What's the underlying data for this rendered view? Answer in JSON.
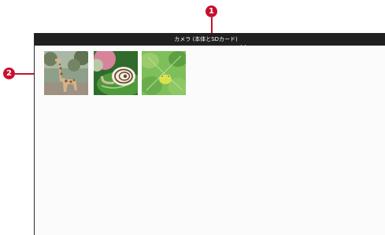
{
  "callouts": {
    "one": "1",
    "two": "2"
  },
  "header": {
    "album_title": "カメラ (本体とSDカード)",
    "dropdown_icon": "chevron-down-icon"
  },
  "thumbnails": [
    {
      "subject": "giraffe"
    },
    {
      "subject": "snail"
    },
    {
      "subject": "frog"
    }
  ],
  "colors": {
    "callout": "#c8102e",
    "titlebar": "#202020",
    "title_text": "#ffffff",
    "background": "#fbfbfb"
  }
}
